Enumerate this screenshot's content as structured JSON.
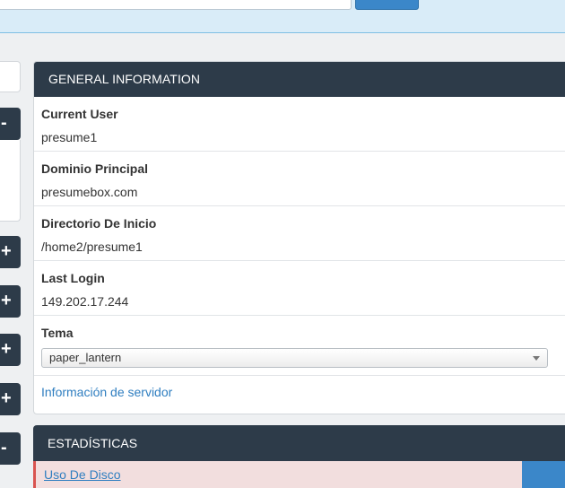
{
  "general_information": {
    "title": "GENERAL INFORMATION",
    "rows": [
      {
        "label": "Current User",
        "value": "presume1"
      },
      {
        "label": "Dominio Principal",
        "value": "presumebox.com"
      },
      {
        "label": "Directorio De Inicio",
        "value": "/home2/presume1"
      },
      {
        "label": "Last Login",
        "value": "149.202.17.244"
      }
    ],
    "theme": {
      "label": "Tema",
      "selected": "paper_lantern"
    },
    "server_info_link": "Información de servidor"
  },
  "statistics": {
    "title": "ESTADÍSTICAS",
    "first_row_label": "Uso De Disco"
  },
  "left_toggles": [
    "-",
    "+",
    "+",
    "+",
    "+",
    "-"
  ],
  "colors": {
    "panel_header": "#2d3b49",
    "link": "#2f7ec0",
    "accent_button": "#3b87c9",
    "warning_row": "#f2dede"
  }
}
